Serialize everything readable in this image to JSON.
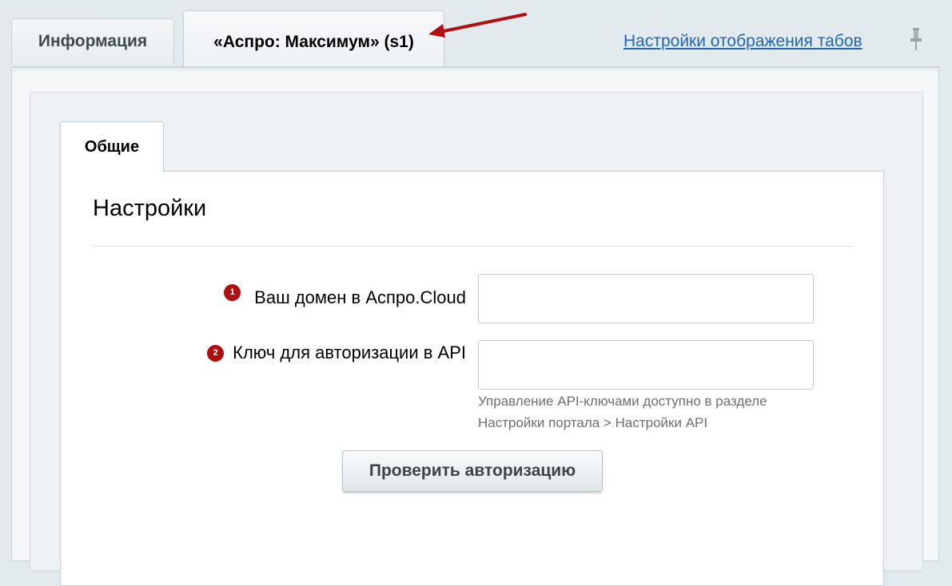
{
  "tabs": {
    "info_label": "Информация",
    "site_label": "«Аспро: Максимум» (s1)"
  },
  "header": {
    "tab_settings_link": "Настройки отображения табов"
  },
  "subtabs": {
    "general_label": "Общие"
  },
  "settings": {
    "title": "Настройки",
    "fields": [
      {
        "badge": "1",
        "label": "Ваш домен в Аспро.Cloud",
        "value": ""
      },
      {
        "badge": "2",
        "label": "Ключ для авторизации в API",
        "value": ""
      }
    ],
    "hint_line1": "Управление API-ключами доступно в разделе",
    "hint_line2": "Настройки портала > Настройки API",
    "check_button_label": "Проверить авторизацию"
  },
  "colors": {
    "badge": "#b10e10",
    "link": "#2067b0",
    "annotation_arrow": "#b10e10"
  },
  "icons": [
    "pin-icon",
    "red-arrow-annotation"
  ]
}
